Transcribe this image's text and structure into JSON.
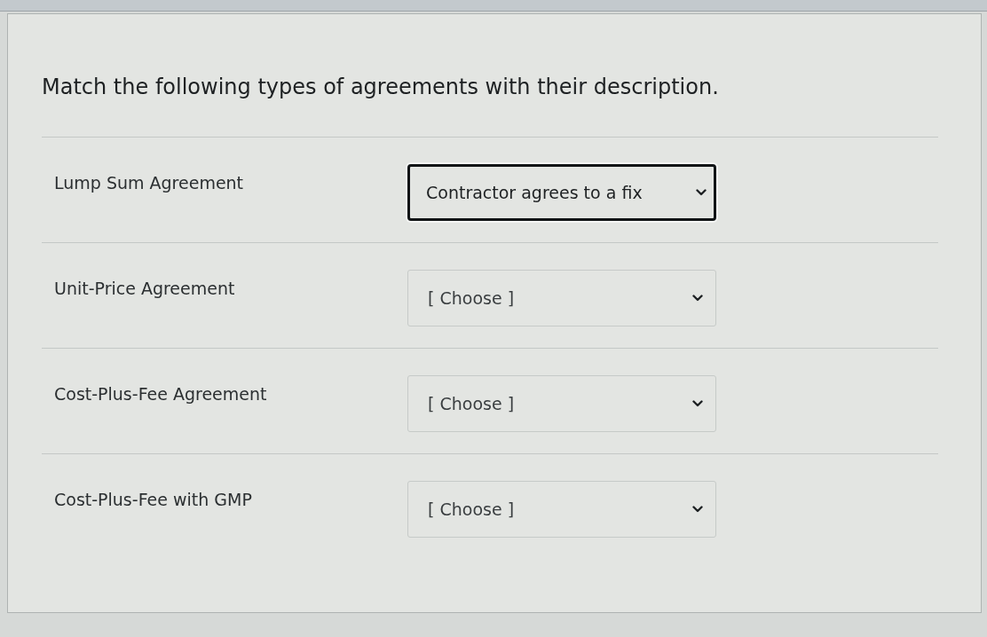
{
  "question": {
    "prompt": "Match the following types of agreements with their description."
  },
  "matches": [
    {
      "term": "Lump Sum Agreement",
      "answer": "Contractor agrees to a fix",
      "focused": true
    },
    {
      "term": "Unit-Price Agreement",
      "answer": "[ Choose ]",
      "focused": false
    },
    {
      "term": "Cost-Plus-Fee Agreement",
      "answer": "[ Choose ]",
      "focused": false
    },
    {
      "term": "Cost-Plus-Fee with GMP",
      "answer": "[ Choose ]",
      "focused": false
    }
  ]
}
